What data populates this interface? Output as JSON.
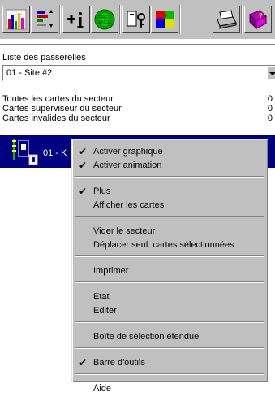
{
  "toolbar": {
    "buttons": [
      {
        "icon": "bar-chart-icon"
      },
      {
        "icon": "sort-list-icon"
      },
      {
        "icon": "add-info-icon"
      },
      {
        "icon": "presence-globe-icon"
      },
      {
        "icon": "cards-key-icon"
      },
      {
        "icon": "puzzle-map-icon"
      },
      {
        "icon": "printer-icon"
      },
      {
        "icon": "help-book-icon"
      }
    ],
    "globe_text": "PRES ENCE"
  },
  "gateway": {
    "label": "Liste des passerelles",
    "selected": "01 - Site #2"
  },
  "stats": [
    {
      "label": "Toutes les cartes du secteur",
      "value": "0"
    },
    {
      "label": "Cartes superviseur du secteur",
      "value": "0"
    },
    {
      "label": "Cartes invalides du secteur",
      "value": "0"
    }
  ],
  "selected_item": {
    "label": "01 - K"
  },
  "context_menu": {
    "groups": [
      [
        {
          "label": "Activer graphique",
          "checked": true
        },
        {
          "label": "Activer animation",
          "checked": true
        }
      ],
      [
        {
          "label": "Plus",
          "checked": true
        },
        {
          "label": "Afficher les cartes",
          "checked": false
        }
      ],
      [
        {
          "label": "Vider le secteur",
          "checked": false
        },
        {
          "label": "Déplacer seul. cartes sélectionnées",
          "checked": false
        }
      ],
      [
        {
          "label": "Imprimer",
          "checked": false
        }
      ],
      [
        {
          "label": "Etat",
          "checked": false
        },
        {
          "label": "Editer",
          "checked": false
        }
      ],
      [
        {
          "label": "Boîte de sélection étendue",
          "checked": false
        }
      ],
      [
        {
          "label": "Barre d'outils",
          "checked": true
        }
      ],
      [
        {
          "label": "Aide",
          "checked": false
        }
      ]
    ]
  },
  "colors": {
    "selection": "#000080",
    "face": "#c0c0c0"
  }
}
